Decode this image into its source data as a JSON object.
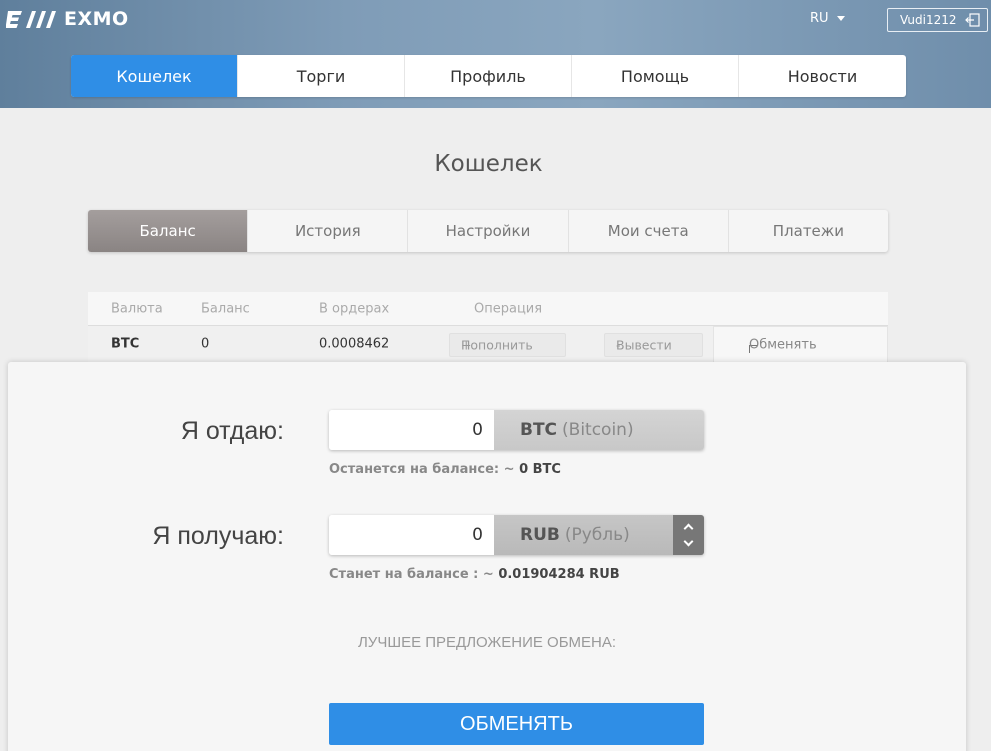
{
  "header": {
    "logo_text": "EXMO",
    "language": "RU",
    "username": "Vudi1212"
  },
  "main_nav": [
    {
      "label": "Кошелек",
      "active": true
    },
    {
      "label": "Торги",
      "active": false
    },
    {
      "label": "Профиль",
      "active": false
    },
    {
      "label": "Помощь",
      "active": false
    },
    {
      "label": "Новости",
      "active": false
    }
  ],
  "page_title": "Кошелек",
  "sub_tabs": [
    {
      "label": "Баланс",
      "active": true
    },
    {
      "label": "История",
      "active": false
    },
    {
      "label": "Настройки",
      "active": false
    },
    {
      "label": "Мои счета",
      "active": false
    },
    {
      "label": "Платежи",
      "active": false
    }
  ],
  "table": {
    "headers": [
      "Валюта",
      "Баланс",
      "В ордерах",
      "Операция"
    ],
    "row": {
      "currency": "BTC",
      "balance": "0",
      "in_orders": "0.0008462",
      "deposit_label": "Пополнить",
      "deposit_sign": "+",
      "withdraw_label": "Вывести",
      "withdraw_sign": "-",
      "exchange_label": "Обменять"
    }
  },
  "exchange": {
    "give_label": "Я отдаю:",
    "give_amount": "0",
    "give_currency_code": "BTC",
    "give_currency_name": "(Bitcoin)",
    "give_hint_label": "Останется на балансе: ~",
    "give_hint_value": "0 BTC",
    "receive_label": "Я получаю:",
    "receive_amount": "0",
    "receive_currency_code": "RUB",
    "receive_currency_name": "(Рубль)",
    "receive_hint_label": "Станет на балансе : ~",
    "receive_hint_value": "0.01904284 RUB",
    "best_offer_label": "ЛУЧШЕЕ ПРЕДЛОЖЕНИЕ ОБМЕНА:",
    "submit_label": "ОБМЕНЯТЬ"
  },
  "colors": {
    "accent": "#2f8ee6",
    "header_bg": "#7f9cb7",
    "active_subtab": "#8a8483"
  }
}
